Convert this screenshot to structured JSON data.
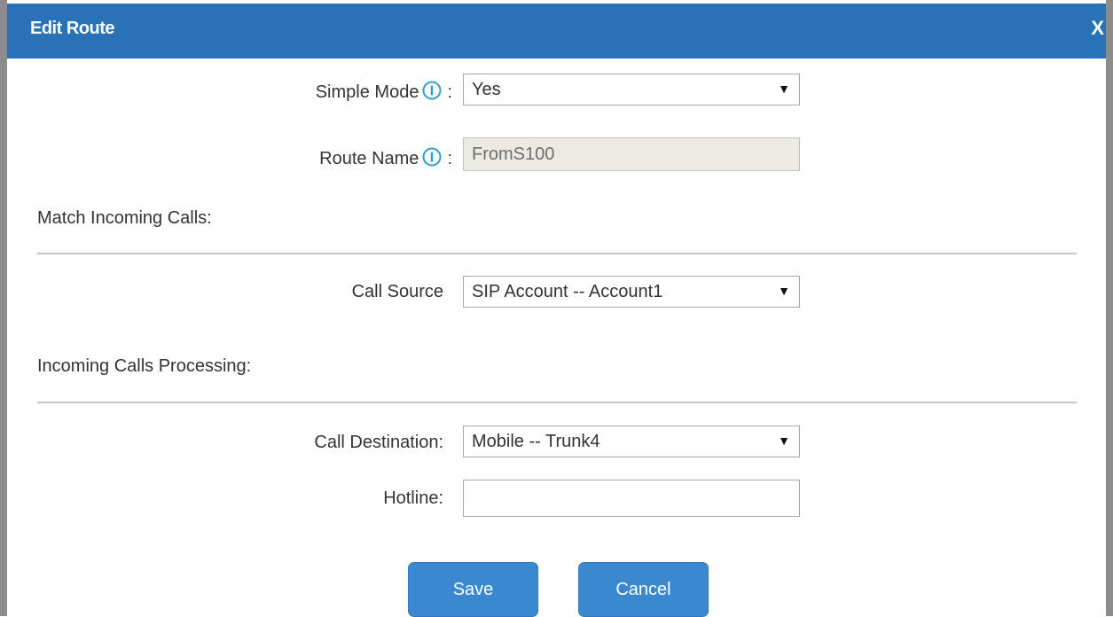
{
  "dialog": {
    "title": "Edit Route",
    "close_label": "X"
  },
  "simple_mode": {
    "label": "Simple Mode",
    "colon": ":",
    "value": "Yes"
  },
  "route_name": {
    "label": "Route Name",
    "colon": ":",
    "value": "FromS100"
  },
  "match_section": {
    "title": "Match Incoming Calls:"
  },
  "call_source": {
    "label": "Call Source",
    "value": "SIP Account -- Account1"
  },
  "processing_section": {
    "title": "Incoming Calls Processing:"
  },
  "call_destination": {
    "label": "Call Destination:",
    "value": "Mobile -- Trunk4"
  },
  "hotline": {
    "label": "Hotline:",
    "value": ""
  },
  "buttons": {
    "save": "Save",
    "cancel": "Cancel"
  },
  "icons": {
    "info": "info-icon",
    "dropdown": "dropdown-arrow-icon"
  },
  "colors": {
    "title_bar": "#2a72b8",
    "button": "#3a89d0",
    "info_icon": "#2e9bd6"
  }
}
